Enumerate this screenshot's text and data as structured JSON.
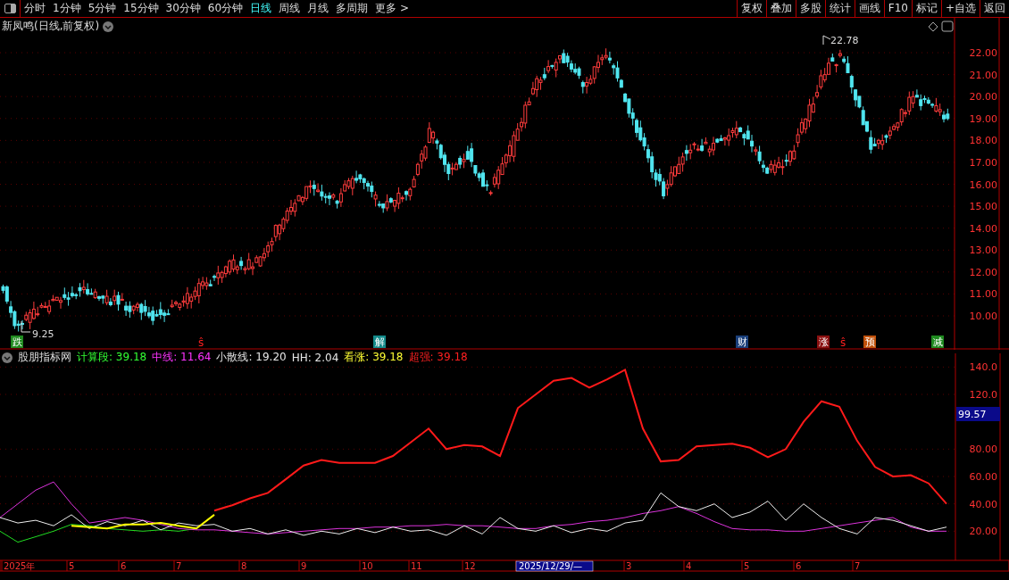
{
  "toolbar": {
    "periods": [
      {
        "label": "分时",
        "selected": false
      },
      {
        "label": "1分钟",
        "selected": false
      },
      {
        "label": "5分钟",
        "selected": false
      },
      {
        "label": "15分钟",
        "selected": false
      },
      {
        "label": "30分钟",
        "selected": false
      },
      {
        "label": "60分钟",
        "selected": false
      },
      {
        "label": "日线",
        "selected": true
      },
      {
        "label": "周线",
        "selected": false
      },
      {
        "label": "月线",
        "selected": false
      },
      {
        "label": "多周期",
        "selected": false
      },
      {
        "label": "更多 >",
        "selected": false
      }
    ],
    "buttons": [
      "复权",
      "叠加",
      "多股",
      "统计",
      "画线",
      "F10",
      "标记",
      "+自选",
      "返回"
    ]
  },
  "price_chart": {
    "title": "新凤鸣(日线,前复权)",
    "high_label": "22.78",
    "low_label": "9.25",
    "axis_labels": [
      "22.00",
      "21.00",
      "20.00",
      "19.00",
      "18.00",
      "17.00",
      "16.00",
      "15.00",
      "14.00",
      "13.00",
      "12.00",
      "11.00",
      "10.00"
    ],
    "signals": [
      {
        "text": "跌",
        "kind": "badge",
        "color": "#1f8a1f"
      },
      {
        "text": "ŝ",
        "kind": "mark",
        "color": "#ff2020"
      },
      {
        "text": "解",
        "kind": "badge",
        "color": "#138a8a"
      },
      {
        "text": "财",
        "kind": "badge",
        "color": "#1a3f7a"
      },
      {
        "text": "涨",
        "kind": "badge",
        "color": "#8a1010"
      },
      {
        "text": "ŝ",
        "kind": "mark",
        "color": "#ff2020"
      },
      {
        "text": "预",
        "kind": "badge",
        "color": "#c0500a"
      },
      {
        "text": "减",
        "kind": "badge",
        "color": "#1f8a1f"
      }
    ]
  },
  "indicator": {
    "name": "股朋指标网",
    "values": [
      {
        "text": "计算段: 39.18",
        "color": "#33ff33"
      },
      {
        "text": "中线: 11.64",
        "color": "#ff33ff"
      },
      {
        "text": "小散线: 19.20",
        "color": "#e6e6e6"
      },
      {
        "text": "HH: 2.04",
        "color": "#e6e6e6"
      },
      {
        "text": "看涨: 39.18",
        "color": "#ffff33"
      },
      {
        "text": "超强: 39.18",
        "color": "#ff2020"
      }
    ],
    "cursor_value": "99.57",
    "chart_data": {
      "type": "line",
      "ylim": [
        0,
        150
      ],
      "grid": true,
      "yticks": [
        {
          "value": 140,
          "label": "140.0"
        },
        {
          "value": 120,
          "label": "120.0"
        },
        {
          "value": 80,
          "label": "80.00"
        },
        {
          "value": 60,
          "label": "60.00"
        },
        {
          "value": 40,
          "label": "40.00"
        },
        {
          "value": 20,
          "label": "20.00"
        }
      ],
      "series": [
        {
          "color": "#22dd22",
          "values": [
            20,
            12,
            16,
            20,
            25,
            24,
            22,
            21,
            20,
            21,
            20,
            22,
            null,
            null,
            null,
            null,
            null,
            null,
            null,
            null,
            null,
            null,
            null,
            null,
            null,
            null,
            null,
            null,
            null,
            null,
            null,
            null,
            null,
            null,
            null,
            null,
            null,
            null,
            null,
            null,
            null,
            null,
            null,
            null,
            null,
            null,
            null,
            null,
            null,
            null,
            null,
            null,
            null,
            null
          ]
        },
        {
          "color": "#dd33dd",
          "values": [
            30,
            40,
            50,
            56,
            40,
            26,
            28,
            30,
            28,
            25,
            22,
            21,
            21,
            20,
            19,
            18,
            19,
            20,
            21,
            22,
            22,
            23,
            23,
            24,
            24,
            25,
            24,
            24,
            23,
            22,
            22,
            24,
            25,
            27,
            28,
            30,
            33,
            35,
            38,
            33,
            27,
            22,
            21,
            21,
            20,
            20,
            22,
            24,
            26,
            28,
            30,
            23,
            20,
            20
          ]
        },
        {
          "color": "#eeeeee",
          "values": [
            30,
            26,
            28,
            24,
            32,
            22,
            27,
            24,
            28,
            21,
            26,
            24,
            25,
            20,
            22,
            18,
            21,
            17,
            20,
            18,
            22,
            19,
            23,
            20,
            21,
            17,
            24,
            18,
            30,
            22,
            20,
            24,
            19,
            22,
            20,
            26,
            28,
            48,
            38,
            35,
            40,
            30,
            34,
            42,
            28,
            40,
            30,
            22,
            18,
            30,
            28,
            24,
            20,
            23
          ]
        },
        {
          "color": "#ffff00",
          "values": [
            null,
            null,
            null,
            null,
            24,
            23,
            22,
            25,
            25,
            26,
            24,
            22,
            32,
            null,
            null,
            null,
            null,
            null,
            null,
            null,
            null,
            null,
            null,
            null,
            null,
            null,
            null,
            null,
            null,
            null,
            null,
            null,
            null,
            null,
            null,
            null,
            null,
            null,
            null,
            null,
            null,
            null,
            null,
            null,
            null,
            null,
            null,
            null,
            null,
            null,
            null,
            null,
            null,
            null
          ]
        },
        {
          "color": "#ff1a1a",
          "values": [
            null,
            null,
            null,
            null,
            null,
            null,
            null,
            null,
            null,
            null,
            null,
            null,
            35,
            39,
            44,
            48,
            58,
            68,
            72,
            70,
            70,
            70,
            75,
            85,
            95,
            80,
            83,
            82,
            75,
            110,
            120,
            130,
            132,
            125,
            131,
            138,
            95,
            71,
            72,
            82,
            83,
            84,
            81,
            74,
            80,
            100,
            115,
            111,
            86,
            67,
            60,
            61,
            55,
            40
          ]
        }
      ]
    }
  },
  "date_axis": [
    {
      "label": "2025年",
      "selected": false
    },
    {
      "label": "5",
      "selected": false
    },
    {
      "label": "6",
      "selected": false
    },
    {
      "label": "7",
      "selected": false
    },
    {
      "label": "8",
      "selected": false
    },
    {
      "label": "9",
      "selected": false
    },
    {
      "label": "10",
      "selected": false
    },
    {
      "label": "11",
      "selected": false
    },
    {
      "label": "12",
      "selected": false
    },
    {
      "label": "2025/12/29/—",
      "selected": true
    },
    {
      "label": "3",
      "selected": false
    },
    {
      "label": "4",
      "selected": false
    },
    {
      "label": "5",
      "selected": false
    },
    {
      "label": "6",
      "selected": false
    },
    {
      "label": "7",
      "selected": false
    }
  ]
}
